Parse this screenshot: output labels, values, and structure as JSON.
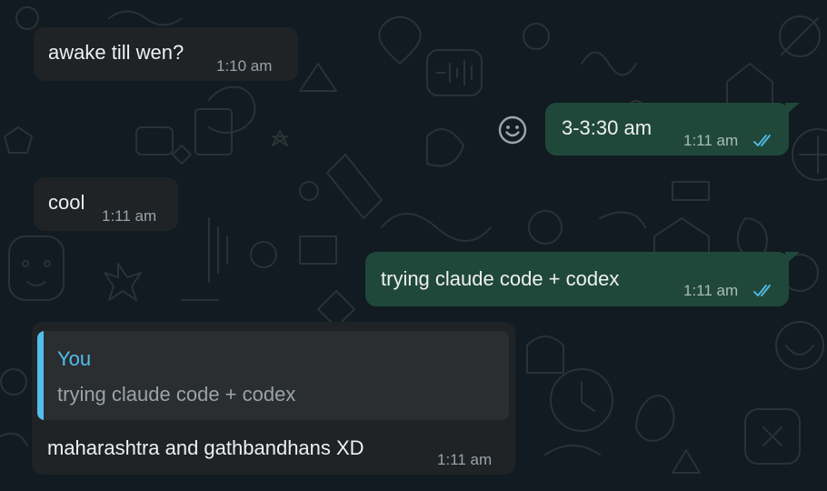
{
  "chat": {
    "messages": [
      {
        "direction": "in",
        "text": "awake till wen?",
        "time": "1:10 am"
      },
      {
        "direction": "out",
        "text": "3-3:30 am",
        "time": "1:11 am",
        "status": "read"
      },
      {
        "direction": "in",
        "text": "cool",
        "time": "1:11 am"
      },
      {
        "direction": "out",
        "text": "trying claude code + codex",
        "time": "1:11 am",
        "status": "read"
      },
      {
        "direction": "in",
        "quote": {
          "author": "You",
          "text": "trying claude code + codex"
        },
        "text": "maharashtra and gathbandhans XD",
        "time": "1:11 am"
      }
    ],
    "icons": {
      "react": "smiley-face-icon",
      "read_receipt": "double-check-icon"
    },
    "colors": {
      "background": "#111b21",
      "incoming_bubble": "#1f2326",
      "outgoing_bubble": "#20483a",
      "read_tick": "#53bdeb",
      "quote_accent": "#53bdeb"
    }
  }
}
